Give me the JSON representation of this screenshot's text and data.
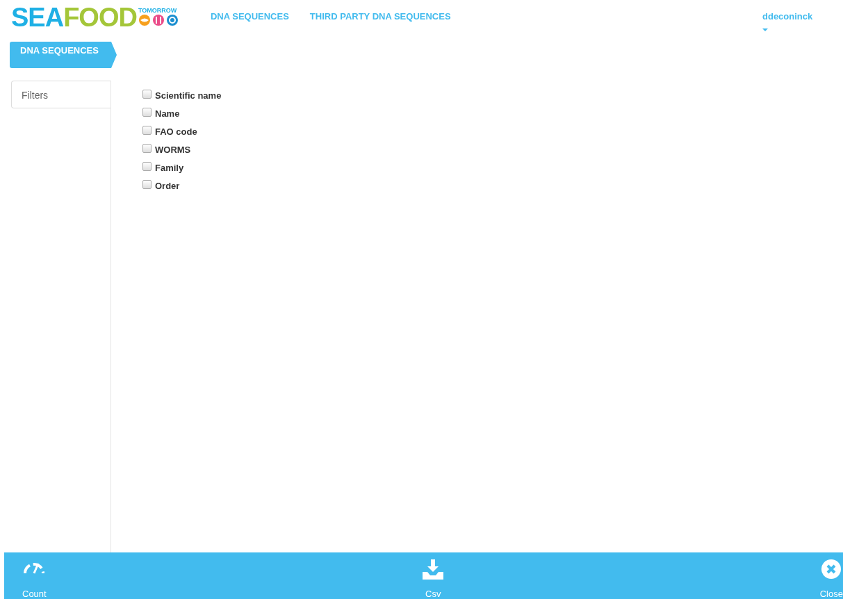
{
  "logo": {
    "parts": [
      {
        "text": "SEA",
        "color": "#1fb0e5"
      },
      {
        "text": "FOOD",
        "color": "#a4c639"
      }
    ],
    "tagline": "TOMORROW"
  },
  "nav": [
    {
      "label": "DNA SEQUENCES"
    },
    {
      "label": "THIRD PARTY DNA SEQUENCES"
    }
  ],
  "user": {
    "name": "ddeconinck"
  },
  "sidebar": {
    "title": "DNA SEQUENCES",
    "filters": "Filters"
  },
  "fields": [
    {
      "label": "Scientific name",
      "checked": false
    },
    {
      "label": "Name",
      "checked": false
    },
    {
      "label": "FAO code",
      "checked": false
    },
    {
      "label": "WORMS",
      "checked": false
    },
    {
      "label": "Family",
      "checked": false
    },
    {
      "label": "Order",
      "checked": false
    }
  ],
  "footer": [
    {
      "kind": "count",
      "label": "Count"
    },
    {
      "kind": "csv",
      "label": "Csv"
    },
    {
      "kind": "close",
      "label": "Close"
    }
  ]
}
